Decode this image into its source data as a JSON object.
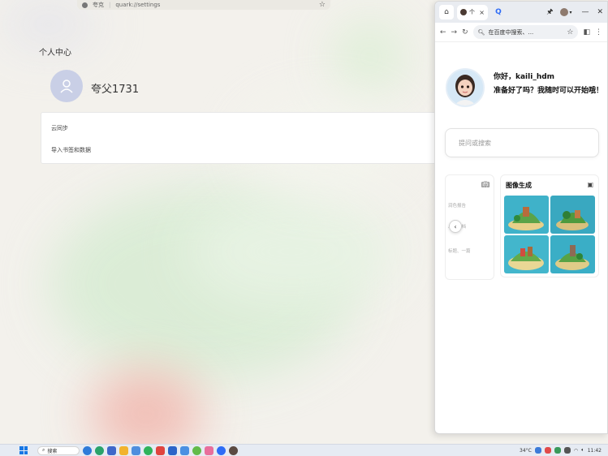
{
  "background_window": {
    "address_label": "夸克",
    "url": "quark://settings",
    "page_title": "个人中心",
    "user_name": "夸父1731",
    "menu_items": [
      "云同步",
      "导入书签和数据"
    ]
  },
  "browser": {
    "tab_label": "个",
    "omnibox_placeholder": "在百度中搜索、...",
    "greeting_line1": "你好，kaili_hdm",
    "greeting_line2": "准备好了吗？我随时可以开始哦！",
    "search_placeholder": "提问或搜索",
    "card_left_faded_lines": [
      "润色报告",
      "总结文档",
      "标题、一篇"
    ],
    "card_right_title": "图像生成"
  },
  "taskbar": {
    "search_label": "搜索",
    "weather": "34°C",
    "time": "11:42"
  },
  "colors": {
    "accent": "#2e6cf6",
    "windows_blue": "#1677e5",
    "panel_bg": "#ffffff"
  }
}
